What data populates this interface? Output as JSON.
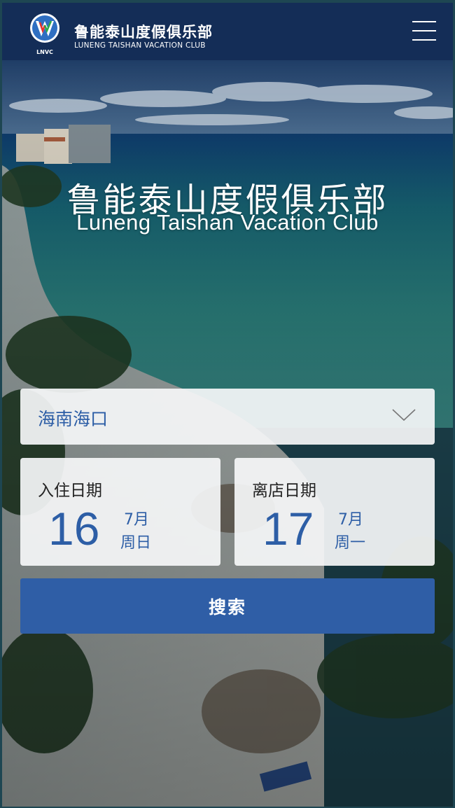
{
  "header": {
    "logo_text": "LNVC",
    "brand_cn": "鲁能泰山度假俱乐部",
    "brand_en": "LUNENG TAISHAN VACATION CLUB",
    "menu_icon": "hamburger-menu-icon"
  },
  "hero": {
    "title_cn": "鲁能泰山度假俱乐部",
    "title_en": "Luneng Taishan Vacation Club"
  },
  "booking": {
    "city": "海南海口",
    "checkin": {
      "label": "入住日期",
      "day": "16",
      "month": "7月",
      "weekday": "周日"
    },
    "checkout": {
      "label": "离店日期",
      "day": "17",
      "month": "7月",
      "weekday": "周一"
    },
    "search_label": "搜索"
  },
  "colors": {
    "header_bg": "#142d57",
    "accent_blue": "#2d5ea6",
    "button_bg": "#2f5ea6"
  }
}
